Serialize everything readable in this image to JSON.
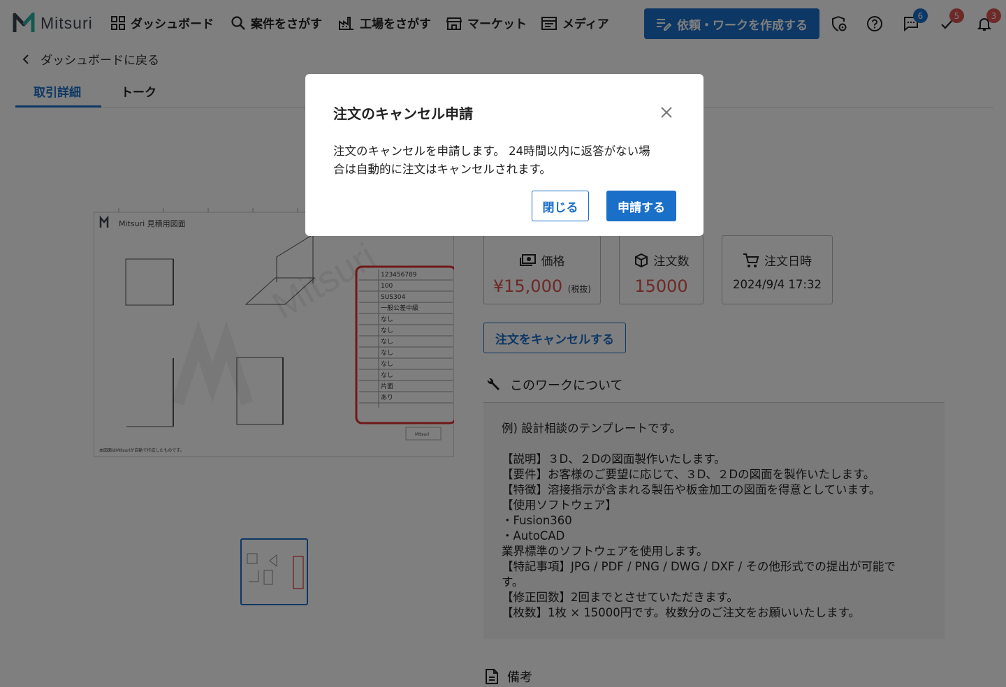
{
  "header": {
    "logo_text": "Mitsuri",
    "nav": [
      {
        "label": "ダッシュボード",
        "icon": "dashboard-icon"
      },
      {
        "label": "案件をさがす",
        "icon": "search-icon"
      },
      {
        "label": "工場をさがす",
        "icon": "factory-icon"
      },
      {
        "label": "マーケット",
        "icon": "store-icon"
      },
      {
        "label": "メディア",
        "icon": "media-icon"
      }
    ],
    "create_label": "依頼・ワークを作成する",
    "badges": {
      "messages": "6",
      "tasks": "5",
      "notifications": "3"
    }
  },
  "back_label": "ダッシュボードに戻る",
  "tabs": [
    {
      "label": "取引詳細"
    },
    {
      "label": "トーク"
    }
  ],
  "drawing": {
    "logo_text": "Mitsuri 見積用図面",
    "watermark": "Mitsuri",
    "table_values": [
      "123456789",
      "100",
      "SUS304",
      "一般公差中級",
      "なし",
      "なし",
      "なし",
      "なし",
      "なし",
      "なし",
      "片面",
      "あり"
    ],
    "footer_note": "本図面はMitsuriが自動で作成したものです。",
    "stamp_text": "Mitsuri"
  },
  "stats": {
    "price": {
      "label": "価格",
      "value": "¥15,000",
      "suffix": "(税抜)"
    },
    "quantity": {
      "label": "注文数",
      "value": "15000"
    },
    "order_date": {
      "label": "注文日時",
      "value": "2024/9/4 17:32"
    }
  },
  "cancel_order_label": "注文をキャンセルする",
  "about": {
    "heading": "このワークについて",
    "lines": [
      "例) 設計相談のテンプレートです。",
      "",
      "【説明】３D、２Dの図面製作いたします。",
      "【要件】お客様のご要望に応じて、３D、２Dの図面を製作いたします。",
      "【特徴】溶接指示が含まれる製缶や板金加工の図面を得意としています。",
      "【使用ソフトウェア】",
      "・Fusion360",
      "・AutoCAD",
      "業界標準のソフトウェアを使用します。",
      "【特記事項】JPG / PDF / PNG / DWG / DXF / その他形式での提出が可能で",
      "す。",
      "【修正回数】2回までとさせていただきます。",
      "【枚数】1枚 × 15000円です。枚数分のご注文をお願いいたします。"
    ]
  },
  "notes_heading": "備考",
  "dialog": {
    "title": "注文のキャンセル申請",
    "body_line1": "注文のキャンセルを申請します。 24時間以内に返答がない場",
    "body_line2": "合は自動的に注文はキャンセルされます。",
    "close_label": "閉じる",
    "submit_label": "申請する"
  },
  "colors": {
    "accent": "#1a6fc9",
    "price": "#d9534f",
    "badge_blue": "#1a6fc9",
    "badge_red": "#d9534f"
  }
}
